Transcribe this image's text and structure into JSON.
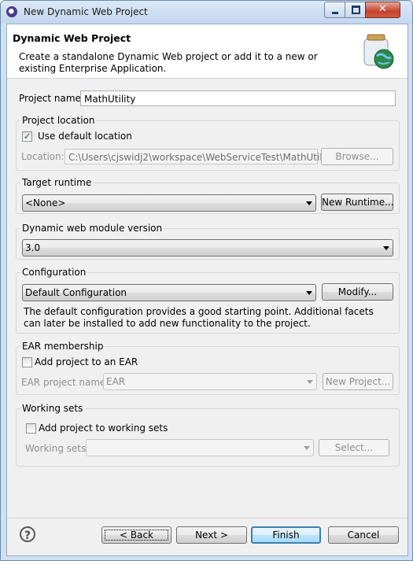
{
  "window": {
    "title": "New Dynamic Web Project"
  },
  "banner": {
    "title": "Dynamic Web Project",
    "description": "Create a standalone Dynamic Web project or add it to a new or existing Enterprise Application."
  },
  "project_name": {
    "label": "Project name:",
    "value": "MathUtility"
  },
  "project_location": {
    "title": "Project location",
    "use_default_label": "Use default location",
    "use_default_checked": true,
    "location_label": "Location:",
    "location_value": "C:\\Users\\cjswidj2\\workspace\\WebServiceTest\\MathUtility",
    "browse_label": "Browse..."
  },
  "target_runtime": {
    "title": "Target runtime",
    "value": "<None>",
    "new_runtime_label": "New Runtime..."
  },
  "module_version": {
    "title": "Dynamic web module version",
    "value": "3.0"
  },
  "configuration": {
    "title": "Configuration",
    "value": "Default Configuration",
    "modify_label": "Modify...",
    "description": "The default configuration provides a good starting point. Additional facets can later be installed to add new functionality to the project."
  },
  "ear_membership": {
    "title": "EAR membership",
    "add_label": "Add project to an EAR",
    "add_checked": false,
    "ear_name_label": "EAR project name:",
    "ear_name_value": "EAR",
    "new_project_label": "New Project..."
  },
  "working_sets": {
    "title": "Working sets",
    "add_label": "Add project to working sets",
    "add_checked": false,
    "sets_label": "Working sets:",
    "sets_value": "",
    "select_label": "Select..."
  },
  "footer": {
    "help_glyph": "?",
    "back_label": "< Back",
    "next_label": "Next >",
    "finish_label": "Finish",
    "cancel_label": "Cancel"
  },
  "icons": {
    "banner": "jar-globe-icon",
    "title": "eclipse-icon",
    "help": "help-icon"
  }
}
